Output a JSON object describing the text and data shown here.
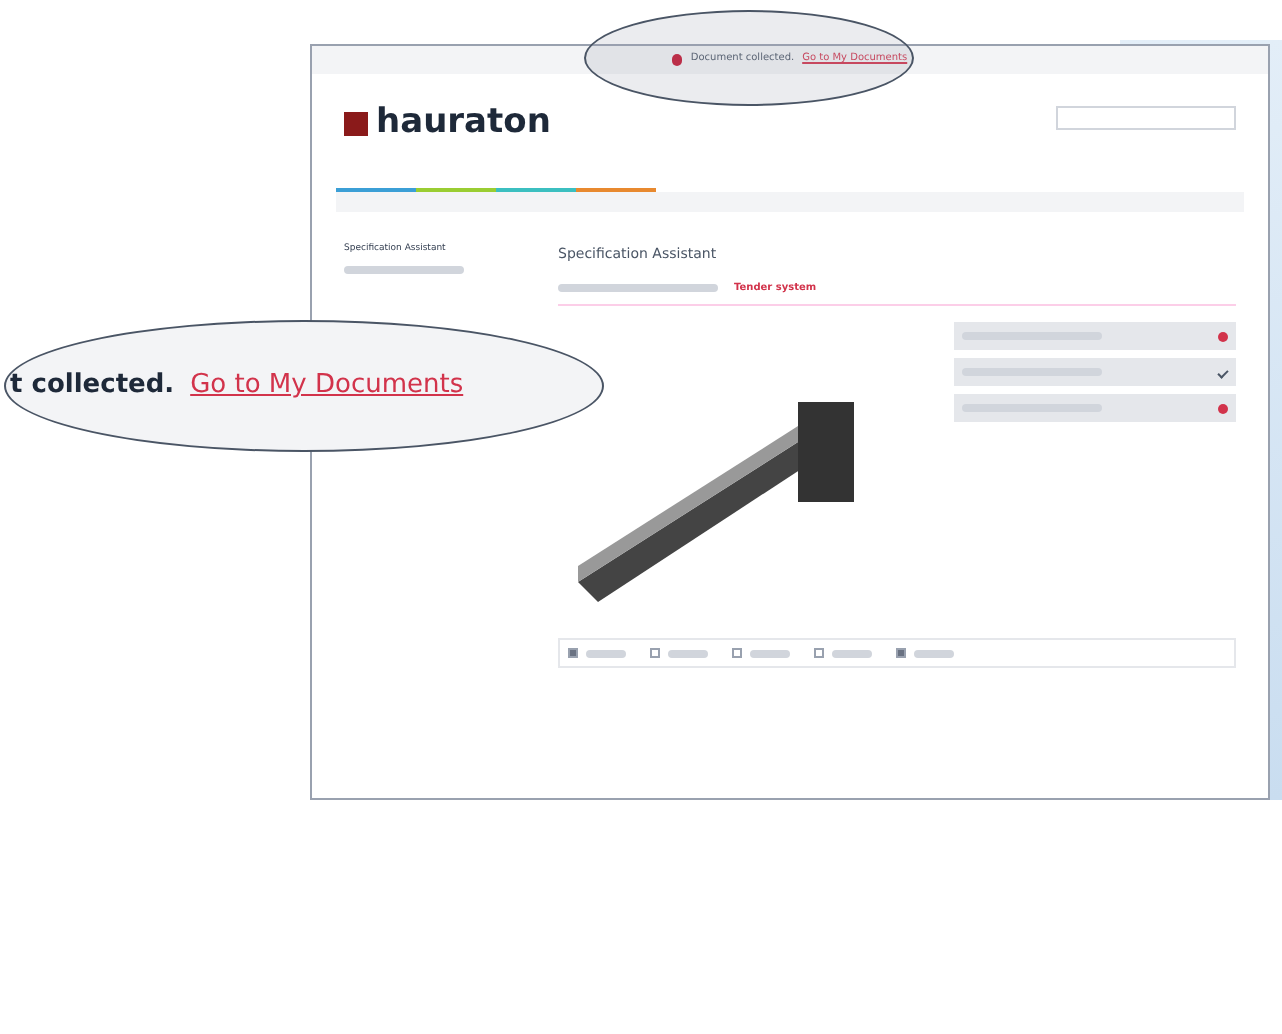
{
  "notification": {
    "text": "Document collected.",
    "link": "Go to My Documents"
  },
  "logo": "hauraton",
  "nav_tabs": [
    {
      "color": "#3b9fd6"
    },
    {
      "color": "#9acd32"
    },
    {
      "color": "#3bbfc0"
    },
    {
      "color": "#e8892f"
    }
  ],
  "sidebar": {
    "items": [
      {
        "label": "Specification Assistant",
        "selected": true
      }
    ]
  },
  "heading": "Specification Assistant",
  "breadcrumb": {
    "current": "Tender system"
  },
  "components": [
    {
      "kind": "remove"
    },
    {
      "kind": "check"
    },
    {
      "kind": "remove"
    }
  ],
  "formats": [
    {
      "checked": true
    },
    {
      "checked": false
    },
    {
      "checked": false
    },
    {
      "checked": false
    },
    {
      "checked": true
    }
  ],
  "callout": {
    "text": "t collected.",
    "link": "Go to My Documents"
  }
}
